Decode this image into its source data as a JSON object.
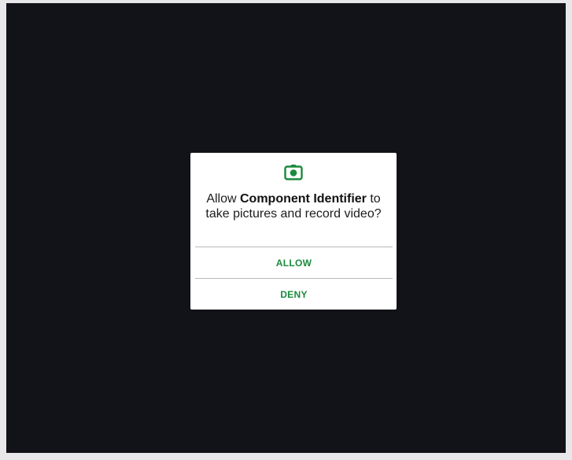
{
  "dialog": {
    "icon": "camera-icon",
    "message_prefix": "Allow ",
    "app_name": "Component Identifier",
    "message_suffix": " to take pictures and record video?",
    "allow_label": "ALLOW",
    "deny_label": "DENY"
  },
  "colors": {
    "accent": "#1a8a3c",
    "screen_background": "#121318",
    "dialog_background": "#ffffff"
  }
}
